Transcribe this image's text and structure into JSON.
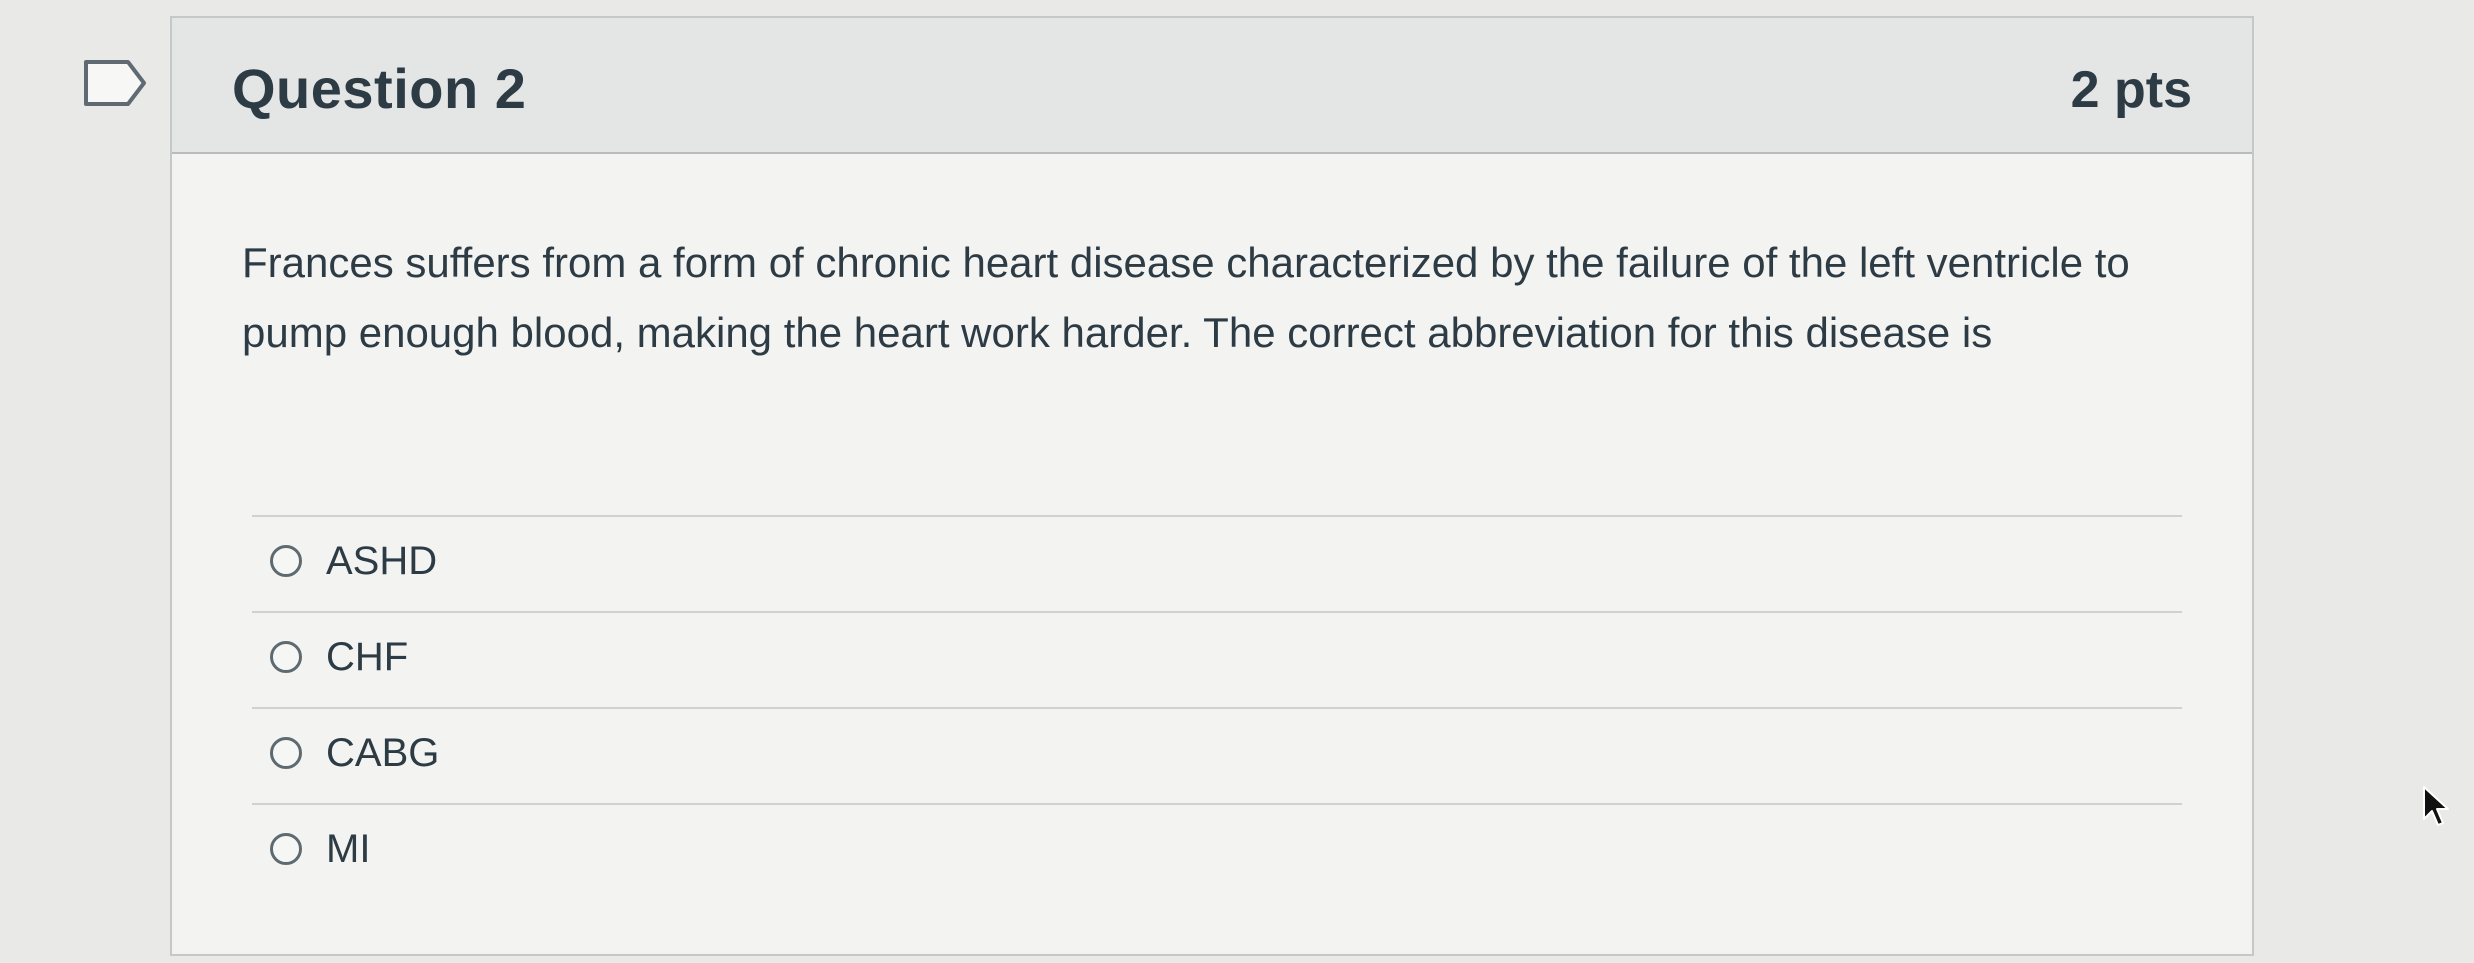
{
  "question": {
    "title": "Question 2",
    "points": "2 pts",
    "text": "Frances suffers from a form of chronic heart disease characterized by the failure of the left ventricle to pump enough blood, making the heart work harder. The correct abbreviation for this disease is",
    "flag_icon": "flag-icon",
    "answers": [
      {
        "label": "ASHD",
        "selected": false
      },
      {
        "label": "CHF",
        "selected": false
      },
      {
        "label": "CABG",
        "selected": false
      },
      {
        "label": "MI",
        "selected": false
      }
    ]
  },
  "cursor_icon": "mouse-pointer-icon",
  "colors": {
    "page_background": "#e9e9e8",
    "card_background": "#f3f3f2",
    "header_background": "#e4e5e5",
    "text": "#2d3b45",
    "divider": "#cfd1d2"
  }
}
